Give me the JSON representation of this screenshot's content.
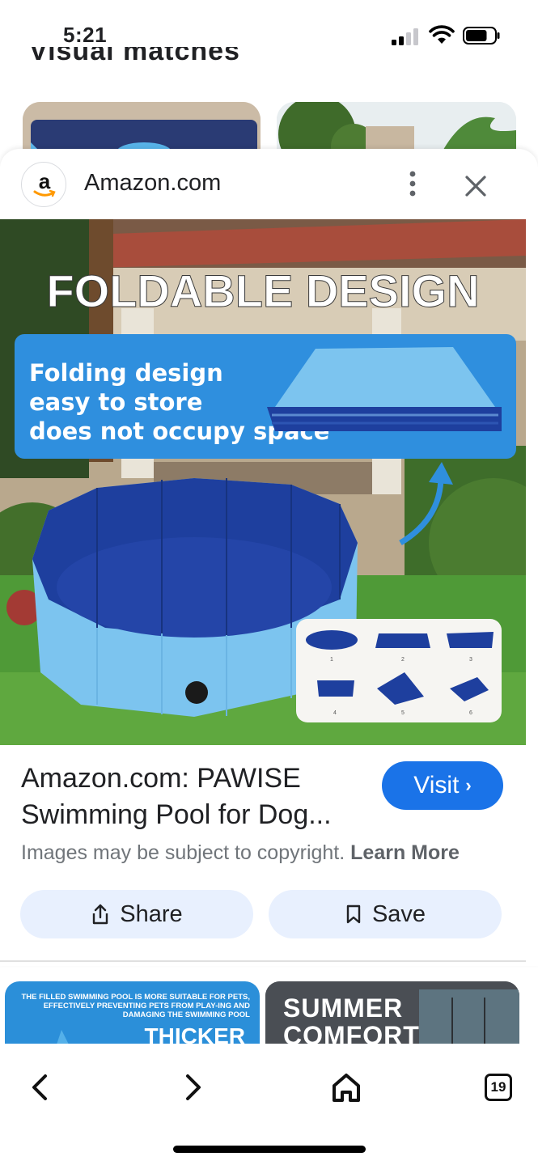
{
  "status_bar": {
    "time": "5:21",
    "signal_bars_active": 2,
    "signal_bars_total": 4,
    "battery_fill": 0.75
  },
  "background": {
    "heading_partial": "Visual matches"
  },
  "sheet": {
    "source": {
      "favicon_letter": "a",
      "name": "Amazon.com"
    },
    "image": {
      "headline": "FOLDABLE DESIGN",
      "caption_lines": [
        "Folding design",
        "easy to store",
        "does not occupy space"
      ],
      "step_numbers": [
        "1",
        "2",
        "3",
        "4",
        "5",
        "6"
      ]
    },
    "title": "Amazon.com: PAWISE Swimming Pool for Dog...",
    "visit_label": "Visit",
    "visit_chevron": "›",
    "copyright_text": "Images may be subject to copyright.",
    "learn_more": "Learn More",
    "share_label": "Share",
    "save_label": "Save"
  },
  "related": [
    {
      "small_text": "THE FILLED SWIMMING POOL IS MORE SUITABLE FOR PETS, EFFECTIVELY PREVENTING PETS FROM PLAY-ING AND DAMAGING THE SWIMMING POOL",
      "big_text": "THICKER"
    },
    {
      "big_text": "SUMMER COMFORT"
    }
  ],
  "toolbar": {
    "tabs_count": "19"
  },
  "colors": {
    "accent": "#1a73e8",
    "pill_bg": "#e8f0fe",
    "pool_light": "#7cc4ef",
    "pool_dark": "#1e3f9e",
    "banner": "#2f8fde"
  },
  "icons": [
    "signal-icon",
    "wifi-icon",
    "battery-icon",
    "amazon-logo",
    "more-vert-icon",
    "close-icon",
    "share-icon",
    "bookmark-icon",
    "back-icon",
    "forward-icon",
    "home-icon",
    "tabs-icon"
  ]
}
